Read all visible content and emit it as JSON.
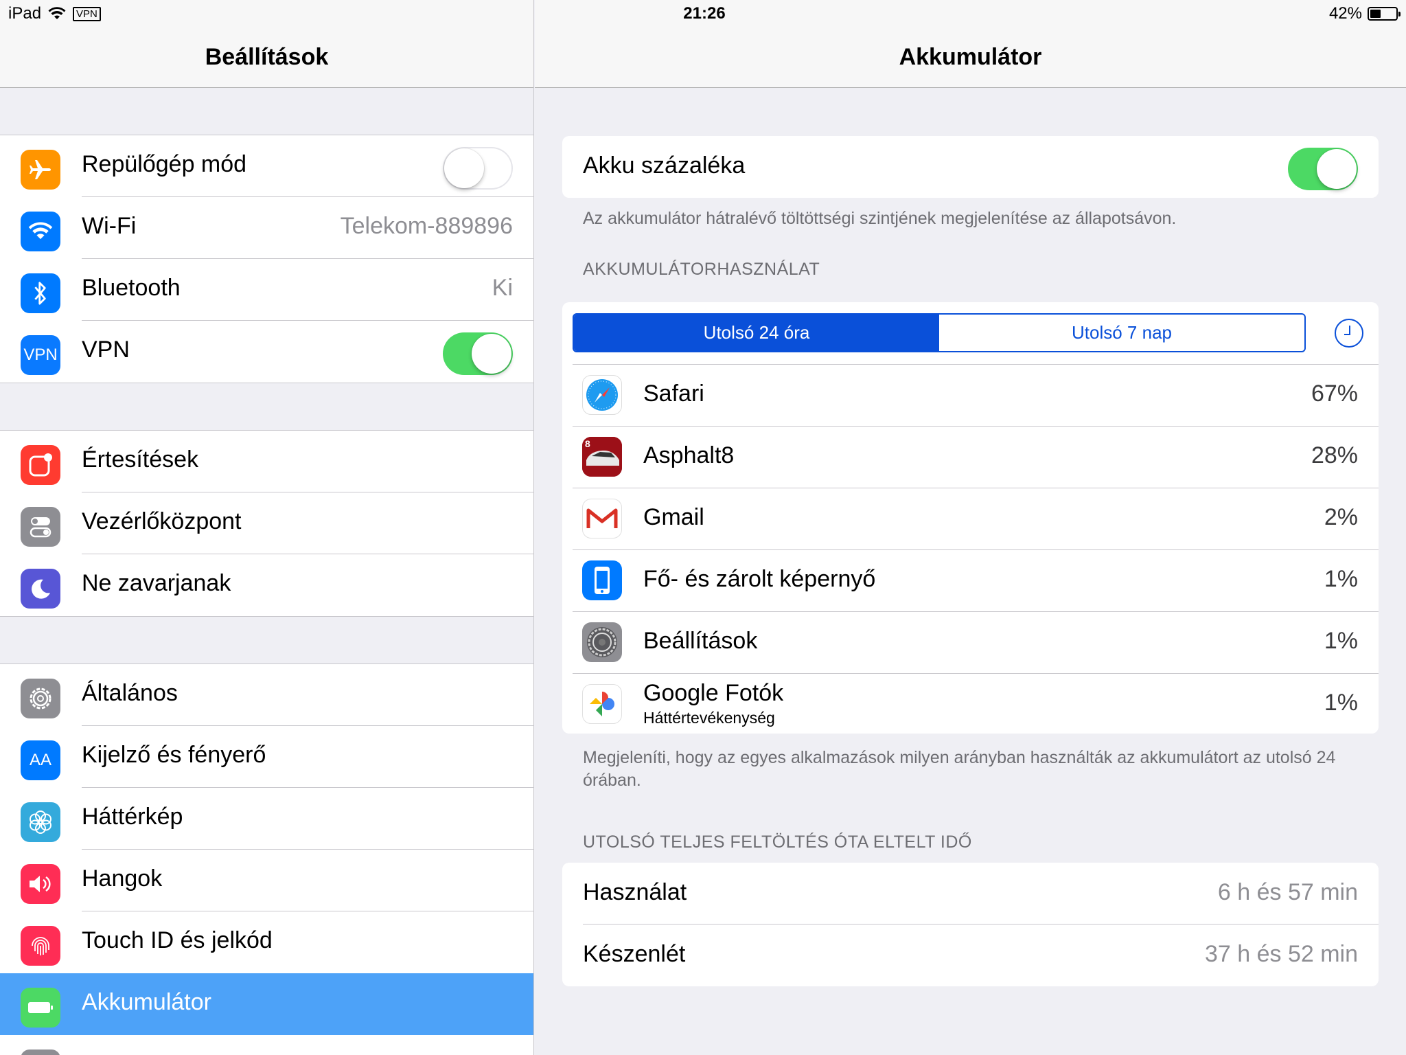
{
  "status_bar": {
    "device": "iPad",
    "vpn_badge": "VPN",
    "time": "21:26",
    "battery_percent": "42%",
    "battery_level": 0.42
  },
  "master": {
    "title": "Beállítások",
    "group1": [
      {
        "label": "Repülőgép mód",
        "icon": "airplane-icon",
        "color": "#ff9500",
        "toggle": false
      },
      {
        "label": "Wi-Fi",
        "icon": "wifi-icon",
        "color": "#007aff",
        "value": "Telekom-889896"
      },
      {
        "label": "Bluetooth",
        "icon": "bluetooth-icon",
        "color": "#007aff",
        "value": "Ki"
      },
      {
        "label": "VPN",
        "icon": "vpn-icon",
        "color": "#0a7aff",
        "icon_text": "VPN",
        "toggle": true
      }
    ],
    "group2": [
      {
        "label": "Értesítések",
        "icon": "notifications-icon",
        "color": "#ff3b30"
      },
      {
        "label": "Vezérlőközpont",
        "icon": "control-center-icon",
        "color": "#8e8e93"
      },
      {
        "label": "Ne zavarjanak",
        "icon": "moon-icon",
        "color": "#5856d6"
      }
    ],
    "group3": [
      {
        "label": "Általános",
        "icon": "gear-icon",
        "color": "#8e8e93"
      },
      {
        "label": "Kijelző és fényerő",
        "icon": "display-icon",
        "color": "#007aff",
        "icon_text": "AA"
      },
      {
        "label": "Háttérkép",
        "icon": "wallpaper-icon",
        "color": "#34aadc"
      },
      {
        "label": "Hangok",
        "icon": "sounds-icon",
        "color": "#ff2d55"
      },
      {
        "label": "Touch ID és jelkód",
        "icon": "fingerprint-icon",
        "color": "#ff2d55"
      },
      {
        "label": "Akkumulátor",
        "icon": "battery-icon",
        "color": "#4cd964",
        "selected": true
      }
    ]
  },
  "detail": {
    "title": "Akkumulátor",
    "battery_percentage_label": "Akku százaléka",
    "battery_percentage_on": true,
    "battery_percentage_footer": "Az akkumulátor hátralévő töltöttségi szintjének megjelenítése az állapotsávon.",
    "usage_header": "AKKUMULÁTORHASZNÁLAT",
    "segments": [
      "Utolsó 24 óra",
      "Utolsó 7 nap"
    ],
    "active_segment": 0,
    "apps": [
      {
        "name": "Safari",
        "percent": "67%",
        "icon": "safari-icon"
      },
      {
        "name": "Asphalt8",
        "percent": "28%",
        "icon": "asphalt8-icon"
      },
      {
        "name": "Gmail",
        "percent": "2%",
        "icon": "gmail-icon"
      },
      {
        "name": "Fő- és zárolt képernyő",
        "percent": "1%",
        "icon": "home-lock-screen-icon"
      },
      {
        "name": "Beállítások",
        "percent": "1%",
        "icon": "settings-gear-icon"
      },
      {
        "name": "Google Fotók",
        "subtitle": "Háttértevékenység",
        "percent": "1%",
        "icon": "google-photos-icon"
      }
    ],
    "usage_footer": "Megjeleníti, hogy az egyes alkalmazások milyen arányban használták az akkumulátort az utolsó 24 órában.",
    "since_charge_header": "UTOLSÓ TELJES FELTÖLTÉS ÓTA ELTELT IDŐ",
    "since_charge": [
      {
        "label": "Használat",
        "value": "6 h és 57 min"
      },
      {
        "label": "Készenlét",
        "value": "37 h és 52 min"
      }
    ]
  }
}
